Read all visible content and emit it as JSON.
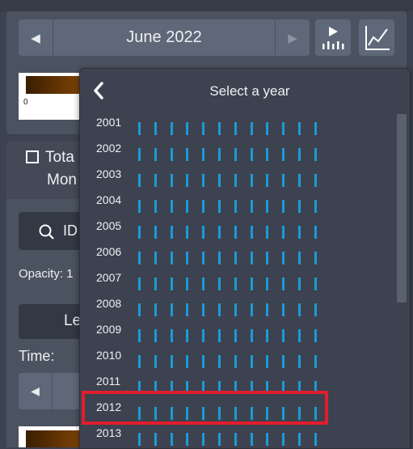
{
  "date_nav": {
    "prev_icon": "caret-left-icon",
    "current": "June 2022",
    "next_icon": "caret-right-icon"
  },
  "toolbar": {
    "play_icon": "play-timeseries-icon",
    "chart_icon": "line-chart-icon"
  },
  "legend": {
    "min_label": "0"
  },
  "layer": {
    "title_line1": "Tota",
    "title_line2": "Mon",
    "identify_label": "ID",
    "opacity_label": "Opacity: 1",
    "legend_button_label": "Le",
    "time_label": "Time:"
  },
  "year_popup": {
    "title": "Select a year",
    "back_icon": "chevron-left-icon",
    "years": [
      "2001",
      "2002",
      "2003",
      "2004",
      "2005",
      "2006",
      "2007",
      "2008",
      "2009",
      "2010",
      "2011",
      "2012",
      "2013"
    ],
    "highlighted_year": "2012",
    "ticks_per_year": 12,
    "tick_color": "#1a9bd8",
    "highlight_color": "#e01e2e"
  }
}
